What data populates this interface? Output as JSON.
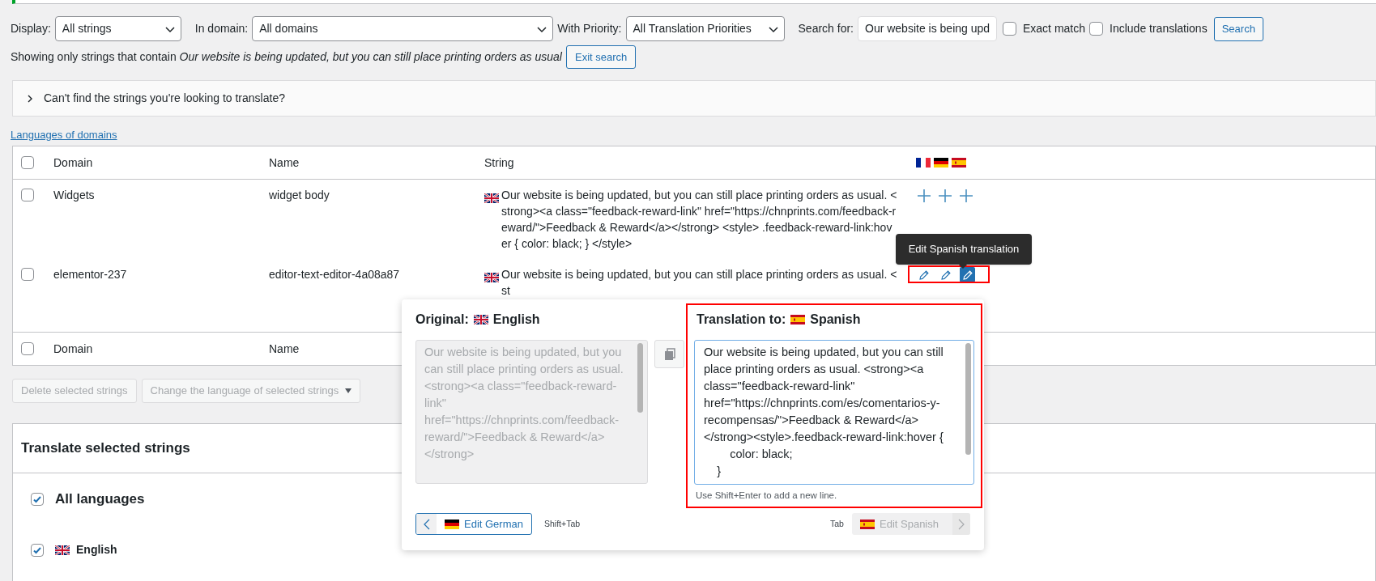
{
  "filters": {
    "display": {
      "label": "Display:",
      "value": "All strings"
    },
    "domain": {
      "label": "In domain:",
      "value": "All domains"
    },
    "priority": {
      "label": "With Priority:",
      "value": "All Translation Priorities"
    },
    "search": {
      "label": "Search for:",
      "value": "Our website is being upd"
    },
    "exact_match": {
      "label": "Exact match",
      "checked": false
    },
    "include_translations": {
      "label": "Include translations",
      "checked": false
    },
    "search_button": "Search"
  },
  "search_notice": {
    "text": "Showing only strings that contain *Our website is being updated, but you can still place printing orders as usual*",
    "exit_button": "Exit search"
  },
  "help_panel": {
    "title": "Can't find the strings you're looking to translate?",
    "expanded": false
  },
  "languages_link": "Languages of domains",
  "table": {
    "columns": [
      "Domain",
      "Name",
      "String"
    ],
    "rows": [
      {
        "checked": false,
        "domain": "Widgets",
        "name": "widget body",
        "string": "Our website is being updated, but you can still place printing orders as usual. <strong><a class=\"feedback-reward-link\" href=\"https://chnprints.com/feedback-reward/\">Feedback & Reward</a></strong> <style> .feedback-reward-link:hover { color: black; } </style>",
        "translations": [
          {
            "kind": "add",
            "selected": false
          },
          {
            "kind": "add",
            "selected": false
          },
          {
            "kind": "add",
            "selected": false
          }
        ]
      },
      {
        "checked": false,
        "domain": "elementor-237",
        "name": "editor-text-editor-4a08a87",
        "string": "Our website is being updated, but you can still place printing orders as usual. <st",
        "translations": [
          {
            "kind": "edit",
            "selected": false
          },
          {
            "kind": "edit",
            "selected": false
          },
          {
            "kind": "edit",
            "selected": true
          }
        ]
      }
    ],
    "footer_columns": [
      "Domain",
      "Name"
    ],
    "footer_checked": false,
    "header_checked": false
  },
  "tooltip": "Edit Spanish translation",
  "editor": {
    "original_label": "Original:",
    "original_language": "English",
    "original_text": "Our website is being updated, but you can still place printing orders as usual. <strong><a class=\"feedback-reward-link\" href=\"https://chnprints.com/feedback-reward/\">Feedback & Reward</a></strong>",
    "translation_label": "Translation to:",
    "translation_language": "Spanish",
    "translation_text": "Our website is being updated, but you can still place printing orders as usual. <strong><a class=\"feedback-reward-link\" href=\"https://chnprints.com/es/comentarios-y-recompensas/\">Feedback & Reward</a></strong><style>.feedback-reward-link:hover {\n        color: black;\n    }",
    "hint": "Use Shift+Enter to add a new line.",
    "prev_button": {
      "label": "Edit German",
      "disabled": false
    },
    "prev_shortcut": "Shift+Tab",
    "next_shortcut": "Tab",
    "next_button": {
      "label": "Edit Spanish",
      "disabled": true
    }
  },
  "bulk_actions": {
    "delete_button": "Delete selected strings",
    "language_select": "Change the language of selected strings"
  },
  "translate_panel": {
    "title": "Translate selected strings",
    "languages": [
      {
        "kind": "all",
        "label": "All languages",
        "checked": true
      },
      {
        "kind": "language",
        "label": "English",
        "checked": true
      }
    ]
  }
}
